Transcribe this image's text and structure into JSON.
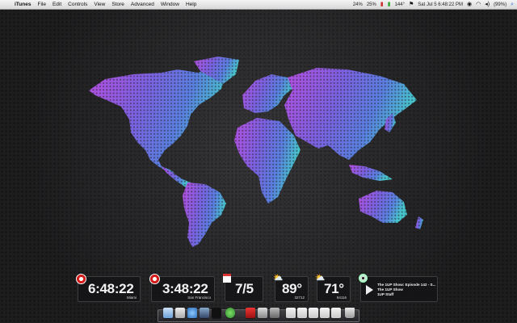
{
  "menubar": {
    "apple_glyph": "",
    "items": [
      "iTunes",
      "File",
      "Edit",
      "Controls",
      "View",
      "Store",
      "Advanced",
      "Window",
      "Help"
    ],
    "status": {
      "cpu_a": "24%",
      "cpu_b": "25%",
      "temp": "144°",
      "datetime": "Sat Jul 5 6:48:22 PM",
      "battery": "(99%)"
    }
  },
  "widgets": {
    "clock1": {
      "time": "6:48:22",
      "city": "Miami"
    },
    "clock2": {
      "time": "3:48:22",
      "city": "San Francisco"
    },
    "calendar": {
      "date": "7/5"
    },
    "weather1": {
      "temp": "89°",
      "zip": "32712"
    },
    "weather2": {
      "temp": "71°",
      "zip": "94116"
    },
    "itunes": {
      "track": "The 1UP Show: Episode 142 - S...",
      "album": "The 1UP Show",
      "artist": "1UP Staff"
    }
  },
  "colors": {
    "map_left": "#b04ad8",
    "map_mid": "#6a6ee0",
    "map_right": "#49c3cf",
    "menubar_bg": "#e6e6e6"
  },
  "icons": {
    "clock": "clock-icon",
    "calendar": "calendar-icon",
    "weather": "sun-cloud-icon",
    "itunes": "cd-icon",
    "play": "play-icon",
    "wifi": "wifi-icon",
    "volume": "volume-icon",
    "spotlight": "spotlight-icon"
  }
}
